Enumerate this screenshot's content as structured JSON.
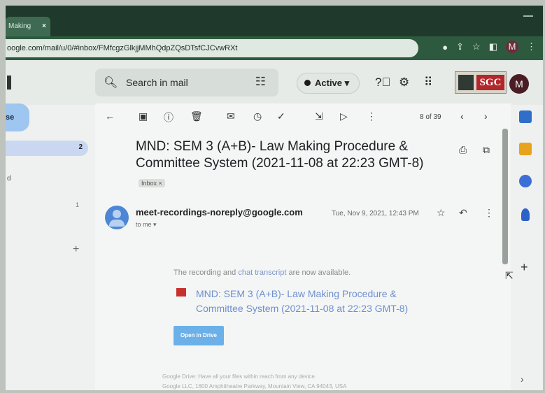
{
  "browser": {
    "tab_title": "Making",
    "tab_close": "×",
    "url": "oogle.com/mail/u/0/#inbox/FMfcgzGlkjjMMhQdpZQsDTsfCJCvwRXt",
    "avatar_letter": "M"
  },
  "header": {
    "search_placeholder": "Search in mail",
    "status_label": "Active",
    "status_caret": "▾",
    "brand_text": "SGC",
    "avatar_letter": "M"
  },
  "sidebar": {
    "compose_fragment": "se",
    "inbox_count": "2",
    "label_fragment": "d",
    "count2": "1",
    "add_label": "+"
  },
  "toolbar": {
    "pager_text": "8 of 39"
  },
  "email": {
    "subject": "MND: SEM 3 (A+B)- Law Making Procedure & Committee System (2021-11-08 at 22:23 GMT-8)",
    "label_chip": "Inbox ×",
    "sender": "meet-recordings-noreply@google.com",
    "to_me": "to me ▾",
    "date": "Tue, Nov 9, 2021, 12:43 PM",
    "body_prefix": "The recording and ",
    "body_link": "chat transcript",
    "body_suffix": " are now available.",
    "recording_link": "MND: SEM 3 (A+B)- Law Making Procedure & Committee System (2021-11-08 at 22:23 GMT-8)",
    "open_button": "Open in Drive",
    "footer_line1": "Google Drive: Have all your files within reach from any device.",
    "footer_line2": "Google LLC, 1600 Amphitheatre Parkway, Mountain View, CA 94043, USA"
  },
  "right_panel": {
    "add": "+",
    "expand": "›"
  },
  "colors": {
    "chrome_dark": "#1f3a2c",
    "accent_blue": "#6f8fd0",
    "brand_red": "#b3262b"
  }
}
